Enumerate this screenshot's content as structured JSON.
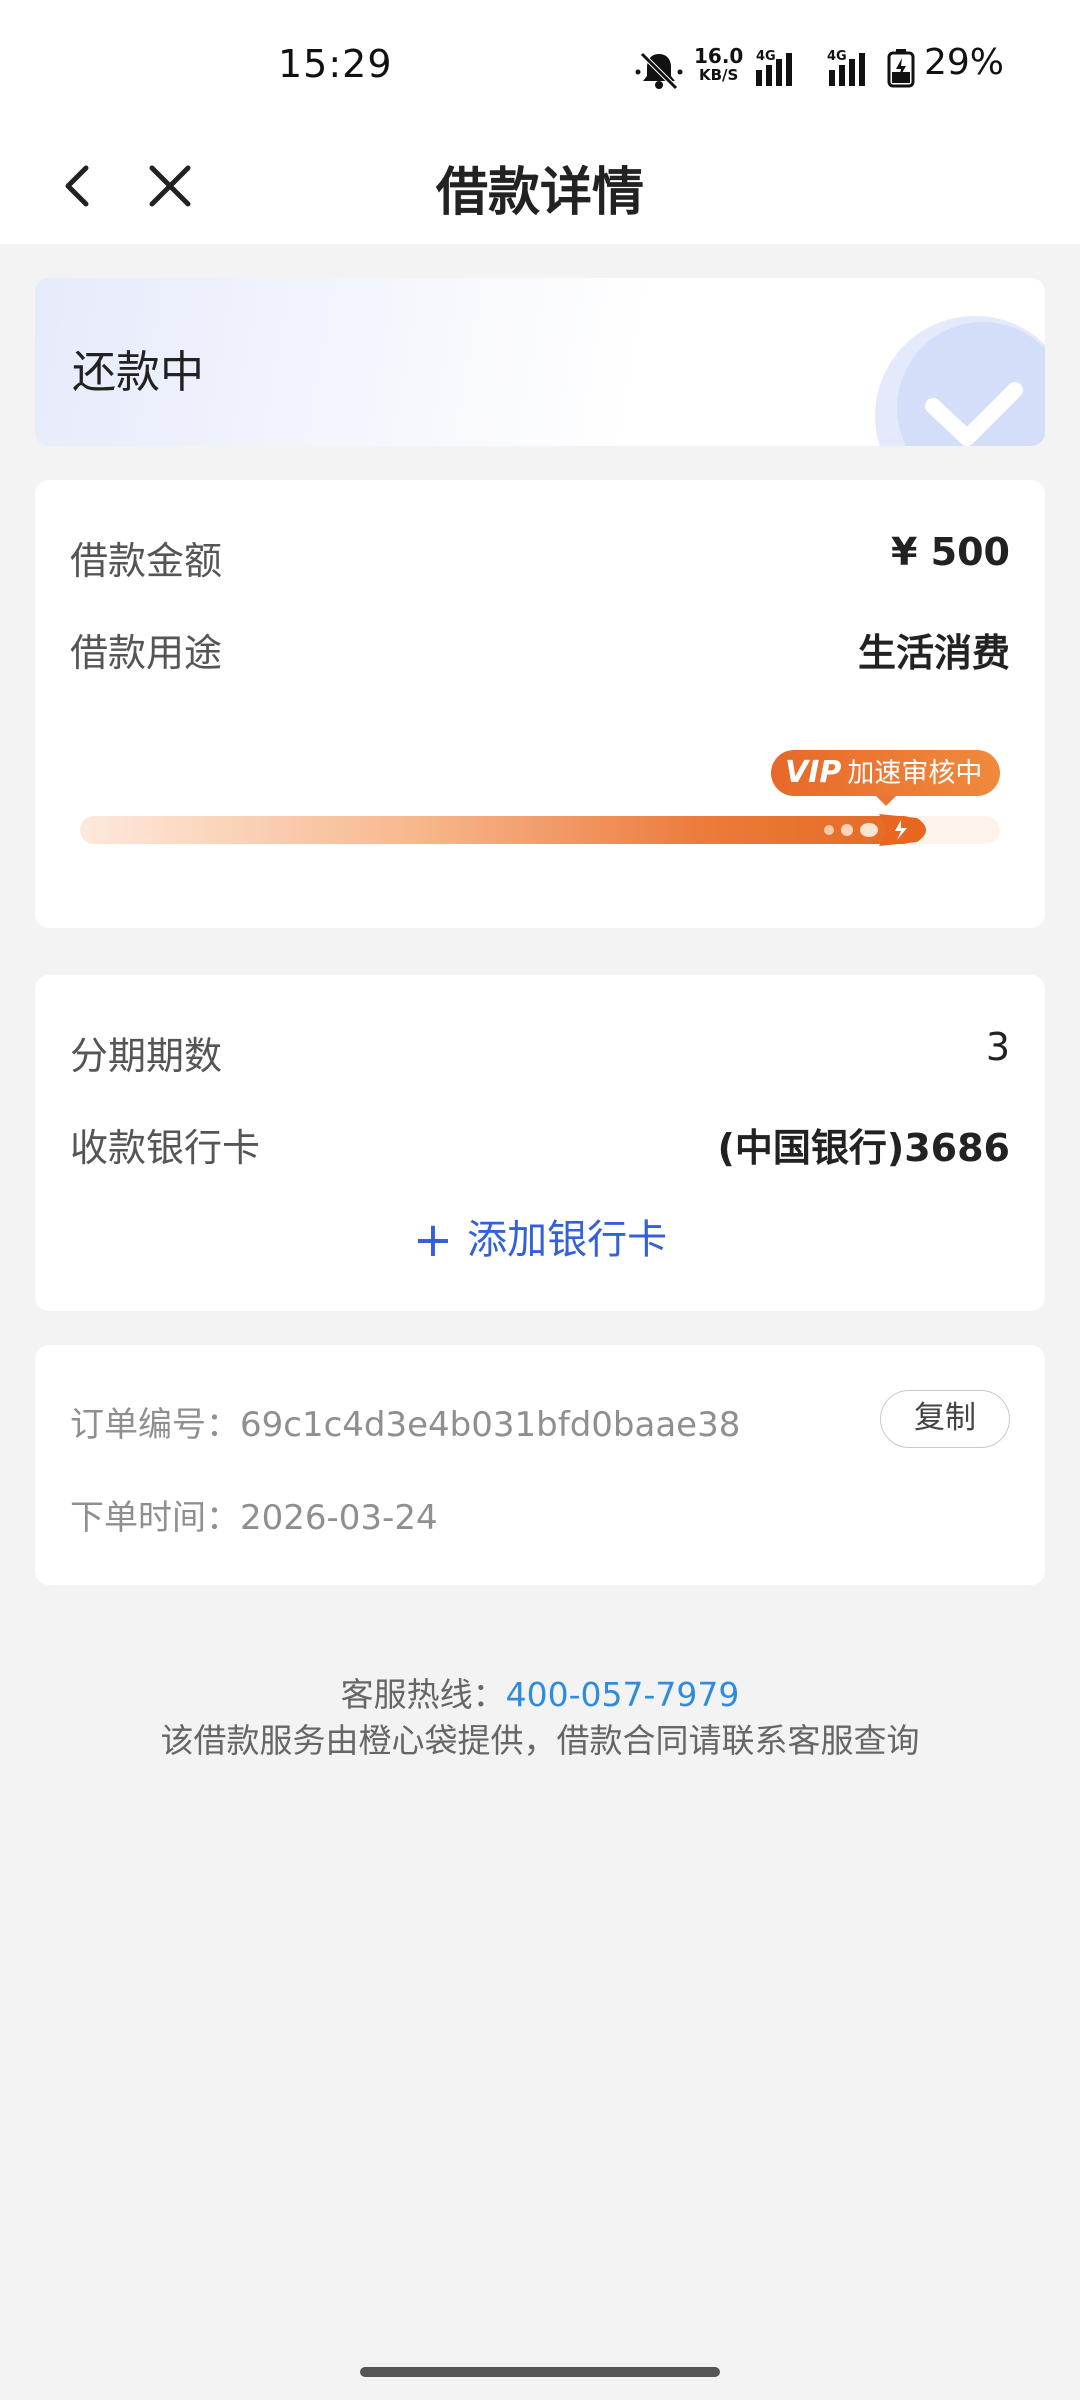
{
  "status_bar": {
    "time": "15:29",
    "net_speed_value": "16.0",
    "net_speed_unit": "KB/S",
    "signal_1_label": "4G",
    "signal_2_label": "4G",
    "battery": "29%",
    "icons": [
      "mute-bell-icon",
      "signal-icon",
      "signal-icon",
      "battery-charging-icon"
    ]
  },
  "nav": {
    "title": "借款详情",
    "back_icon": "chevron-left-icon",
    "close_icon": "close-icon"
  },
  "status_card": {
    "status": "还款中",
    "icon": "check-circle-icon"
  },
  "loan": {
    "amount_label": "借款金额",
    "amount_value": "¥ 500",
    "purpose_label": "借款用途",
    "purpose_value": "生活消费",
    "vip_badge_prefix": "VIP",
    "vip_badge_text": "加速审核中",
    "progress_fraction": 0.91
  },
  "installment": {
    "periods_label": "分期期数",
    "periods_value": "3",
    "bank_label": "收款银行卡",
    "bank_value": "(中国银行)3686",
    "add_card_plus": "+",
    "add_card_label": "添加银行卡"
  },
  "order": {
    "number_label": "订单编号：",
    "number_value": "69c1c4d3e4b031bfd0baae38",
    "copy_label": "复制",
    "time_label": "下单时间：",
    "time_value": "2026-03-24"
  },
  "footer": {
    "hotline_label": "客服热线：",
    "hotline_number": "400-057-7979",
    "note": "该借款服务由橙心袋提供，借款合同请联系客服查询"
  },
  "colors": {
    "accent_blue": "#3460d8",
    "link_blue": "#2f8cdc",
    "vip_orange": "#e8682a",
    "page_bg": "#f3f3f3"
  }
}
